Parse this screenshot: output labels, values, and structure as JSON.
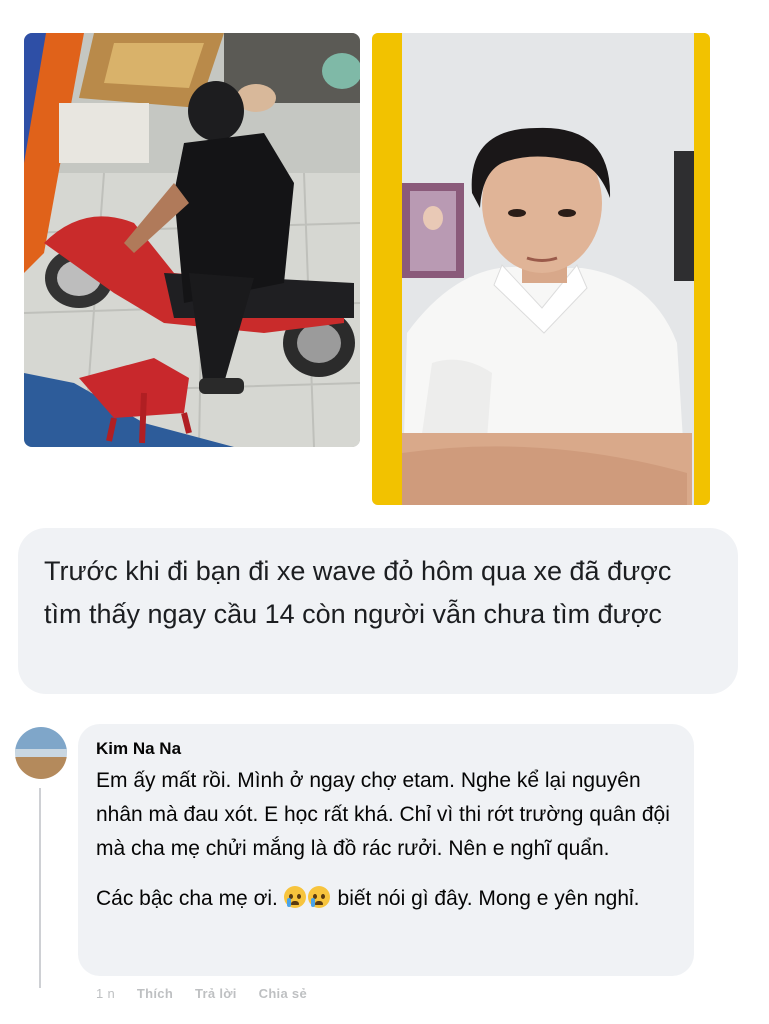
{
  "post": {
    "caption": "Trước khi đi bạn đi xe wave đỏ hôm qua xe đã được tìm thấy ngay cầu 14 còn người vẫn chưa tìm được"
  },
  "comment": {
    "author": "Kim Na Na",
    "paragraph1": "Em ấy mất rồi. Mình ở ngay chợ etam. Nghe kể lại nguyên nhân mà đau xót. E học rất khá. Chỉ vì thi rớt trường quân đội mà cha mẹ chửi mắng là đồ rác rưởi. Nên e nghĩ quẩn.",
    "paragraph2_before": "Các bậc cha mẹ ơi.",
    "paragraph2_after": "biết nói gì đây. Mong e yên nghỉ.",
    "emojis": [
      "crying-face-icon",
      "crying-face-icon"
    ],
    "actions": {
      "time": "1 n",
      "like": "Thích",
      "reply": "Trả lời",
      "share": "Chia sẻ"
    }
  },
  "colors": {
    "bubble": "#f0f2f5",
    "photo_frame_yellow": "#f2c200",
    "thread_line": "#ced0d4"
  }
}
